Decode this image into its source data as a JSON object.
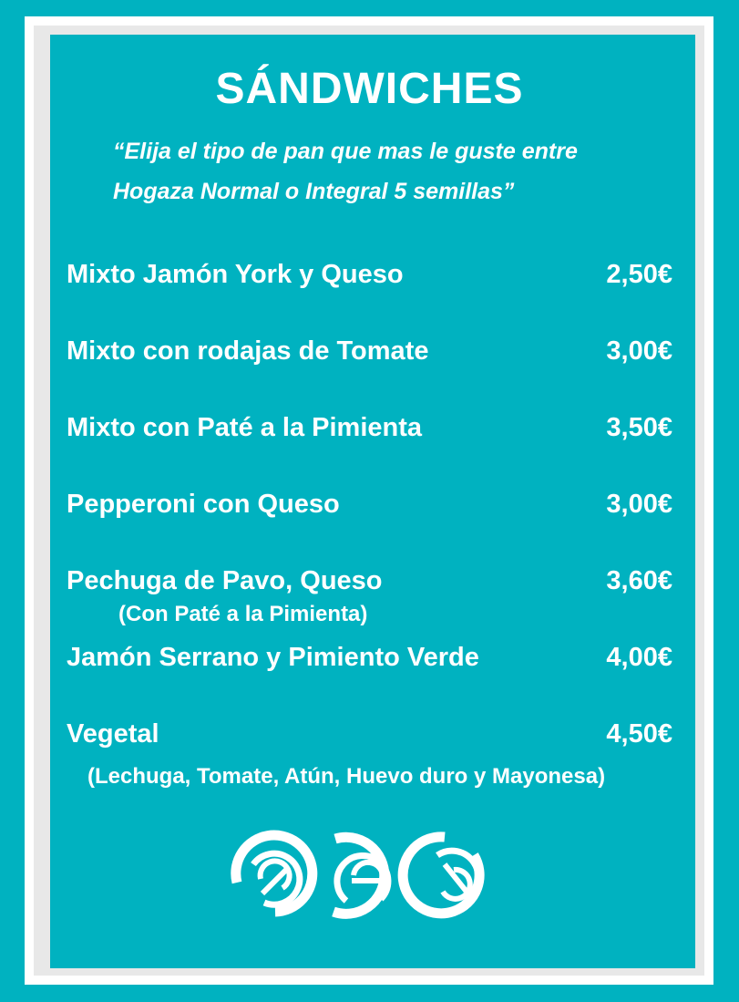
{
  "menu": {
    "title": "SÁNDWICHES",
    "subtitle_line1": "“Elija el tipo de pan que mas le guste entre",
    "subtitle_line2": "Hogaza Normal  o Integral 5 semillas”",
    "items": [
      {
        "name": "Mixto Jamón York y Queso",
        "price": "2,50€"
      },
      {
        "name": "Mixto con rodajas de Tomate",
        "price": "3,00€"
      },
      {
        "name": "Mixto con Paté a la Pimienta",
        "price": "3,50€"
      },
      {
        "name": "Pepperoni con Queso",
        "price": "3,00€"
      },
      {
        "name": "Pechuga de Pavo, Queso",
        "price": "3,60€",
        "note": "(Con Paté a la Pimienta)"
      },
      {
        "name": "Jamón Serrano y Pimiento Verde",
        "price": "4,00€"
      },
      {
        "name": "Vegetal",
        "price": "4,50€",
        "note": "(Lechuga, Tomate, Atún, Huevo duro y Mayonesa)"
      }
    ]
  },
  "colors": {
    "background": "#00b2c0",
    "text": "#ffffff",
    "frame": "#ffffff"
  },
  "logo": {
    "icon": "three-swirl-circles-logo"
  }
}
